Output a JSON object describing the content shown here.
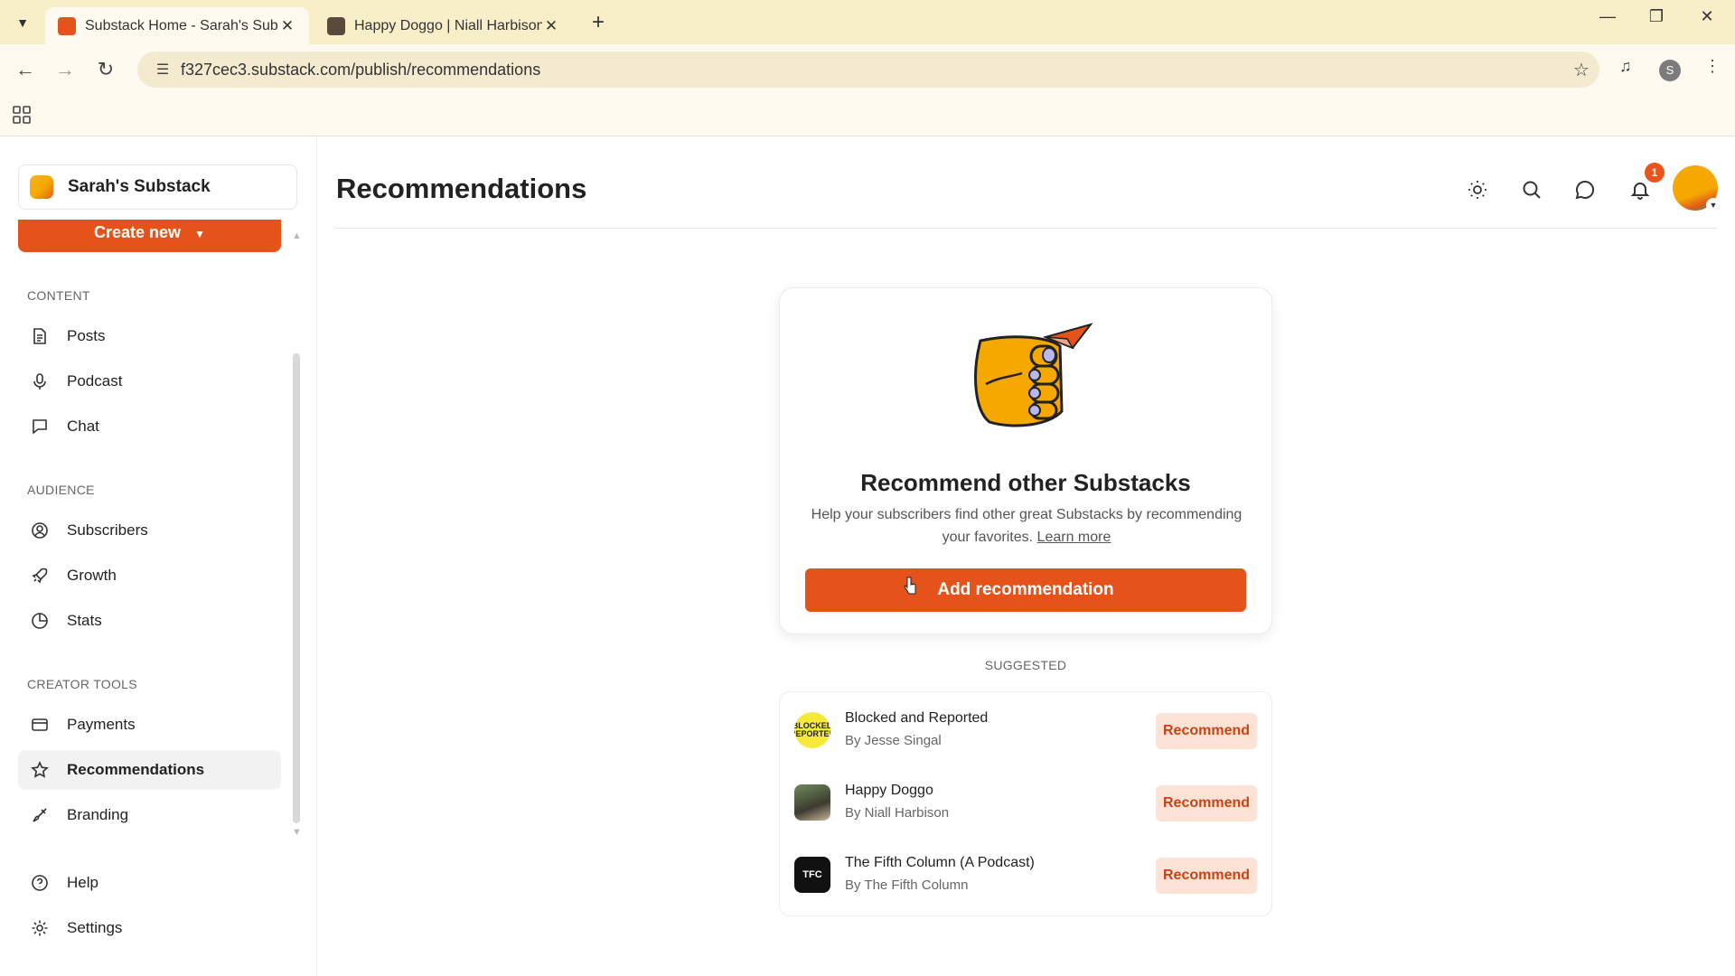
{
  "browser": {
    "tabs": [
      {
        "title": "Substack Home - Sarah's Subst",
        "active": true
      },
      {
        "title": "Happy Doggo | Niall Harbison |",
        "active": false
      }
    ],
    "url": "f327cec3.substack.com/publish/recommendations",
    "profile_initial": "S"
  },
  "sidebar": {
    "publication_name": "Sarah's Substack",
    "create_new_label": "Create new",
    "sections": [
      {
        "label": "CONTENT",
        "items": [
          {
            "label": "Posts",
            "icon": "document-icon"
          },
          {
            "label": "Podcast",
            "icon": "microphone-icon"
          },
          {
            "label": "Chat",
            "icon": "chat-icon"
          }
        ]
      },
      {
        "label": "AUDIENCE",
        "items": [
          {
            "label": "Subscribers",
            "icon": "user-circle-icon"
          },
          {
            "label": "Growth",
            "icon": "rocket-icon"
          },
          {
            "label": "Stats",
            "icon": "pie-chart-icon"
          }
        ]
      },
      {
        "label": "CREATOR TOOLS",
        "items": [
          {
            "label": "Payments",
            "icon": "credit-card-icon"
          },
          {
            "label": "Recommendations",
            "icon": "star-icon",
            "active": true
          },
          {
            "label": "Branding",
            "icon": "brush-icon"
          }
        ]
      }
    ],
    "footer": [
      {
        "label": "Help",
        "icon": "help-icon"
      },
      {
        "label": "Settings",
        "icon": "gear-icon"
      }
    ]
  },
  "header": {
    "title": "Recommendations",
    "notification_count": "1"
  },
  "recommend_card": {
    "heading": "Recommend other Substacks",
    "description": "Help your subscribers find other great Substacks by recommending your favorites.",
    "learn_more": "Learn more",
    "button_label": "Add recommendation"
  },
  "suggested": {
    "label": "SUGGESTED",
    "items": [
      {
        "name": "Blocked and Reported",
        "author": "By Jesse Singal",
        "button": "Recommend"
      },
      {
        "name": "Happy Doggo",
        "author": "By Niall Harbison",
        "button": "Recommend"
      },
      {
        "name": "The Fifth Column (A Podcast)",
        "author": "By The Fifth Column",
        "button": "Recommend"
      }
    ]
  },
  "colors": {
    "accent": "#e5531a",
    "tab_bar": "#f8efc9"
  }
}
